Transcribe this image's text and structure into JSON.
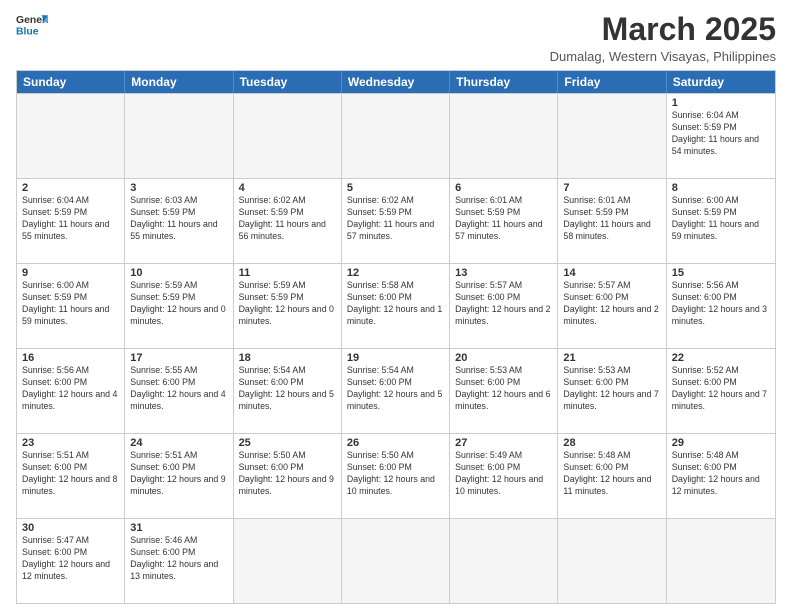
{
  "header": {
    "logo_general": "General",
    "logo_blue": "Blue",
    "title": "March 2025",
    "subtitle": "Dumalag, Western Visayas, Philippines"
  },
  "weekdays": [
    "Sunday",
    "Monday",
    "Tuesday",
    "Wednesday",
    "Thursday",
    "Friday",
    "Saturday"
  ],
  "weeks": [
    [
      {
        "day": "",
        "info": ""
      },
      {
        "day": "",
        "info": ""
      },
      {
        "day": "",
        "info": ""
      },
      {
        "day": "",
        "info": ""
      },
      {
        "day": "",
        "info": ""
      },
      {
        "day": "",
        "info": ""
      },
      {
        "day": "1",
        "info": "Sunrise: 6:04 AM\nSunset: 5:59 PM\nDaylight: 11 hours and 54 minutes."
      }
    ],
    [
      {
        "day": "2",
        "info": "Sunrise: 6:04 AM\nSunset: 5:59 PM\nDaylight: 11 hours and 55 minutes."
      },
      {
        "day": "3",
        "info": "Sunrise: 6:03 AM\nSunset: 5:59 PM\nDaylight: 11 hours and 55 minutes."
      },
      {
        "day": "4",
        "info": "Sunrise: 6:02 AM\nSunset: 5:59 PM\nDaylight: 11 hours and 56 minutes."
      },
      {
        "day": "5",
        "info": "Sunrise: 6:02 AM\nSunset: 5:59 PM\nDaylight: 11 hours and 57 minutes."
      },
      {
        "day": "6",
        "info": "Sunrise: 6:01 AM\nSunset: 5:59 PM\nDaylight: 11 hours and 57 minutes."
      },
      {
        "day": "7",
        "info": "Sunrise: 6:01 AM\nSunset: 5:59 PM\nDaylight: 11 hours and 58 minutes."
      },
      {
        "day": "8",
        "info": "Sunrise: 6:00 AM\nSunset: 5:59 PM\nDaylight: 11 hours and 59 minutes."
      }
    ],
    [
      {
        "day": "9",
        "info": "Sunrise: 6:00 AM\nSunset: 5:59 PM\nDaylight: 11 hours and 59 minutes."
      },
      {
        "day": "10",
        "info": "Sunrise: 5:59 AM\nSunset: 5:59 PM\nDaylight: 12 hours and 0 minutes."
      },
      {
        "day": "11",
        "info": "Sunrise: 5:59 AM\nSunset: 5:59 PM\nDaylight: 12 hours and 0 minutes."
      },
      {
        "day": "12",
        "info": "Sunrise: 5:58 AM\nSunset: 6:00 PM\nDaylight: 12 hours and 1 minute."
      },
      {
        "day": "13",
        "info": "Sunrise: 5:57 AM\nSunset: 6:00 PM\nDaylight: 12 hours and 2 minutes."
      },
      {
        "day": "14",
        "info": "Sunrise: 5:57 AM\nSunset: 6:00 PM\nDaylight: 12 hours and 2 minutes."
      },
      {
        "day": "15",
        "info": "Sunrise: 5:56 AM\nSunset: 6:00 PM\nDaylight: 12 hours and 3 minutes."
      }
    ],
    [
      {
        "day": "16",
        "info": "Sunrise: 5:56 AM\nSunset: 6:00 PM\nDaylight: 12 hours and 4 minutes."
      },
      {
        "day": "17",
        "info": "Sunrise: 5:55 AM\nSunset: 6:00 PM\nDaylight: 12 hours and 4 minutes."
      },
      {
        "day": "18",
        "info": "Sunrise: 5:54 AM\nSunset: 6:00 PM\nDaylight: 12 hours and 5 minutes."
      },
      {
        "day": "19",
        "info": "Sunrise: 5:54 AM\nSunset: 6:00 PM\nDaylight: 12 hours and 5 minutes."
      },
      {
        "day": "20",
        "info": "Sunrise: 5:53 AM\nSunset: 6:00 PM\nDaylight: 12 hours and 6 minutes."
      },
      {
        "day": "21",
        "info": "Sunrise: 5:53 AM\nSunset: 6:00 PM\nDaylight: 12 hours and 7 minutes."
      },
      {
        "day": "22",
        "info": "Sunrise: 5:52 AM\nSunset: 6:00 PM\nDaylight: 12 hours and 7 minutes."
      }
    ],
    [
      {
        "day": "23",
        "info": "Sunrise: 5:51 AM\nSunset: 6:00 PM\nDaylight: 12 hours and 8 minutes."
      },
      {
        "day": "24",
        "info": "Sunrise: 5:51 AM\nSunset: 6:00 PM\nDaylight: 12 hours and 9 minutes."
      },
      {
        "day": "25",
        "info": "Sunrise: 5:50 AM\nSunset: 6:00 PM\nDaylight: 12 hours and 9 minutes."
      },
      {
        "day": "26",
        "info": "Sunrise: 5:50 AM\nSunset: 6:00 PM\nDaylight: 12 hours and 10 minutes."
      },
      {
        "day": "27",
        "info": "Sunrise: 5:49 AM\nSunset: 6:00 PM\nDaylight: 12 hours and 10 minutes."
      },
      {
        "day": "28",
        "info": "Sunrise: 5:48 AM\nSunset: 6:00 PM\nDaylight: 12 hours and 11 minutes."
      },
      {
        "day": "29",
        "info": "Sunrise: 5:48 AM\nSunset: 6:00 PM\nDaylight: 12 hours and 12 minutes."
      }
    ],
    [
      {
        "day": "30",
        "info": "Sunrise: 5:47 AM\nSunset: 6:00 PM\nDaylight: 12 hours and 12 minutes."
      },
      {
        "day": "31",
        "info": "Sunrise: 5:46 AM\nSunset: 6:00 PM\nDaylight: 12 hours and 13 minutes."
      },
      {
        "day": "",
        "info": ""
      },
      {
        "day": "",
        "info": ""
      },
      {
        "day": "",
        "info": ""
      },
      {
        "day": "",
        "info": ""
      },
      {
        "day": "",
        "info": ""
      }
    ]
  ]
}
